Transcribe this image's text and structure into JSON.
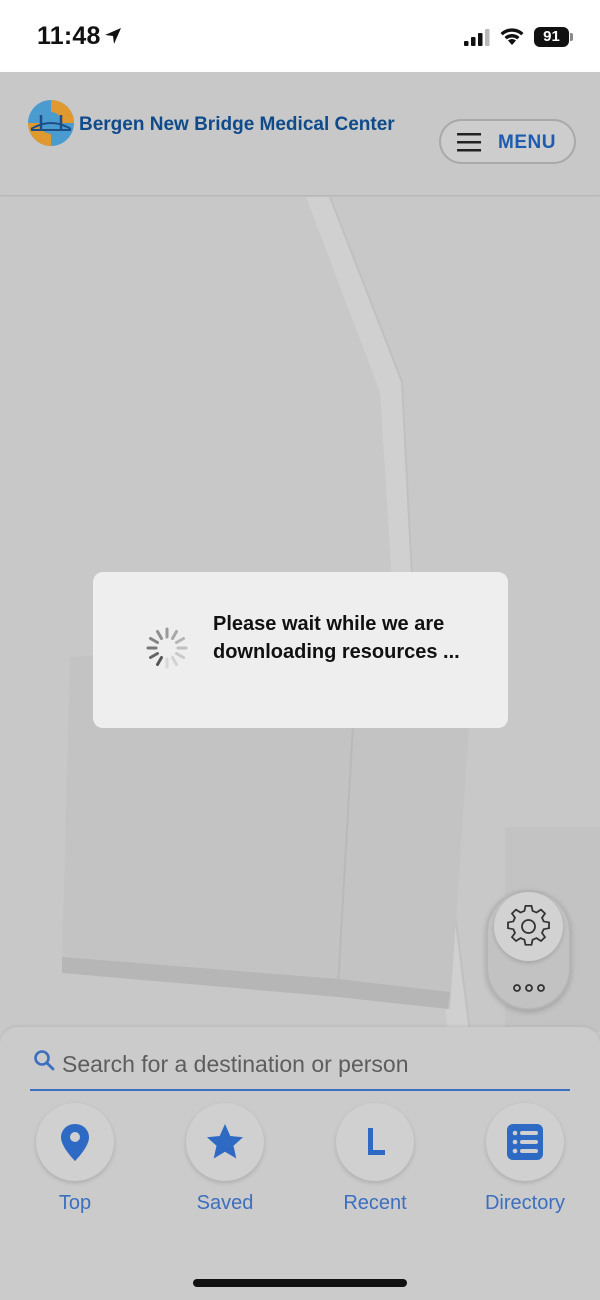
{
  "status_bar": {
    "time": "11:48",
    "battery": "91",
    "icons": [
      "location-arrow-icon",
      "cellular-signal-icon",
      "wifi-icon",
      "battery-icon"
    ]
  },
  "header": {
    "brand_name": "Bergen New Bridge Medical Center",
    "menu_label": "MENU"
  },
  "dialog": {
    "message": "Please wait while we are downloading resources ..."
  },
  "search": {
    "placeholder": "Search for a destination or person"
  },
  "nav": {
    "items": [
      {
        "label": "Top",
        "icon": "map-pin-icon"
      },
      {
        "label": "Saved",
        "icon": "star-icon"
      },
      {
        "label": "Recent",
        "icon": "recent-l-icon"
      },
      {
        "label": "Directory",
        "icon": "directory-list-icon"
      }
    ]
  },
  "colors": {
    "accent_blue": "#3c6fbf",
    "brand_blue": "#0f4a8a",
    "overlay_gray": "#c8c8c8"
  }
}
